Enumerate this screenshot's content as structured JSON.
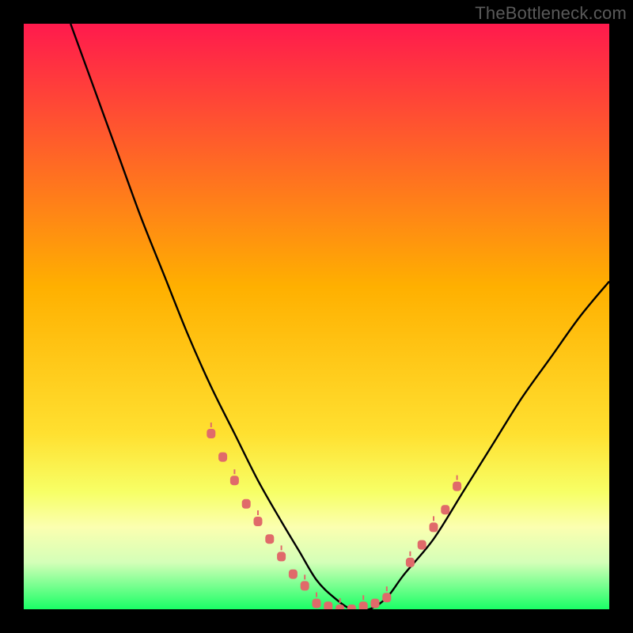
{
  "watermark": "TheBottleneck.com",
  "colors": {
    "bg": "#000000",
    "grad_top": "#ff1a4d",
    "grad_mid": "#ffc400",
    "grad_low": "#f7ff66",
    "grad_band": "#fbffb0",
    "grad_bottom": "#1aff66",
    "curve": "#000000",
    "marker": "#e06a6a"
  },
  "chart_data": {
    "type": "line",
    "title": "",
    "xlabel": "",
    "ylabel": "",
    "xlim": [
      0,
      100
    ],
    "ylim": [
      0,
      100
    ],
    "curve": {
      "x": [
        8,
        12,
        16,
        20,
        24,
        28,
        32,
        36,
        40,
        44,
        47,
        50,
        53,
        56,
        59,
        62,
        65,
        70,
        75,
        80,
        85,
        90,
        95,
        100
      ],
      "y": [
        100,
        89,
        78,
        67,
        57,
        47,
        38,
        30,
        22,
        15,
        10,
        5,
        2,
        0,
        0,
        2,
        6,
        12,
        20,
        28,
        36,
        43,
        50,
        56
      ]
    },
    "markers_left": {
      "x": [
        32,
        34,
        36,
        38,
        40,
        42,
        44,
        46,
        48
      ],
      "y": [
        30,
        26,
        22,
        18,
        15,
        12,
        9,
        6,
        4
      ]
    },
    "markers_valley": {
      "x": [
        50,
        52,
        54,
        56,
        58,
        60,
        62
      ],
      "y": [
        1,
        0.5,
        0,
        0,
        0.5,
        1,
        2
      ]
    },
    "markers_right": {
      "x": [
        66,
        68,
        70,
        72,
        74
      ],
      "y": [
        8,
        11,
        14,
        17,
        21
      ]
    },
    "gradient_stops": [
      {
        "offset": 0.0,
        "color": "#ff1a4d"
      },
      {
        "offset": 0.45,
        "color": "#ffb000"
      },
      {
        "offset": 0.7,
        "color": "#ffe030"
      },
      {
        "offset": 0.8,
        "color": "#f7ff66"
      },
      {
        "offset": 0.86,
        "color": "#fbffb0"
      },
      {
        "offset": 0.92,
        "color": "#d4ffb8"
      },
      {
        "offset": 1.0,
        "color": "#1aff66"
      }
    ]
  }
}
